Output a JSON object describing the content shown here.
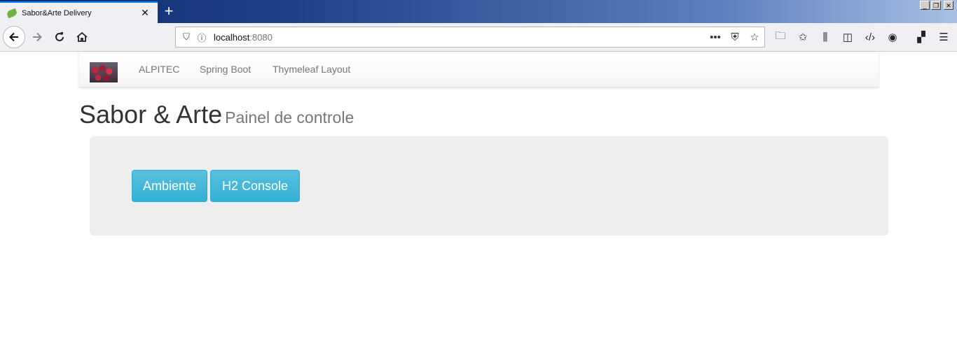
{
  "browser": {
    "tab_title": "Sabor&Arte Delivery",
    "tab_close": "✕",
    "new_tab": "+",
    "url_host": "localhost",
    "url_port": ":8080",
    "page_actions": "•••"
  },
  "navbar": {
    "links": [
      "ALPITEC",
      "Spring Boot",
      "Thymeleaf Layout"
    ]
  },
  "header": {
    "title": "Sabor & Arte",
    "subtitle": "Painel de controle"
  },
  "panel": {
    "buttons": [
      "Ambiente",
      "H2 Console"
    ]
  },
  "colors": {
    "button_info": "#5bc0de",
    "jumbotron_bg": "#eeeeee"
  }
}
